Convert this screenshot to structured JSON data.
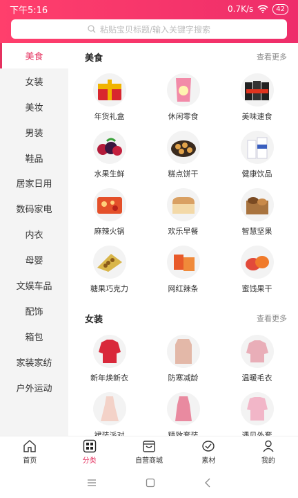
{
  "status": {
    "time": "下午5:16",
    "network": "0.7K/s",
    "battery": "42"
  },
  "search": {
    "placeholder": "粘贴宝贝标题/输入关键字搜索"
  },
  "sidebar": {
    "items": [
      {
        "label": "美食"
      },
      {
        "label": "女装"
      },
      {
        "label": "美妆"
      },
      {
        "label": "男装"
      },
      {
        "label": "鞋品"
      },
      {
        "label": "居家日用"
      },
      {
        "label": "数码家电"
      },
      {
        "label": "内衣"
      },
      {
        "label": "母婴"
      },
      {
        "label": "文娱车品"
      },
      {
        "label": "配饰"
      },
      {
        "label": "箱包"
      },
      {
        "label": "家装家纺"
      },
      {
        "label": "户外运动"
      }
    ]
  },
  "sections": [
    {
      "title": "美食",
      "more": "查看更多",
      "items": [
        {
          "label": "年货礼盒"
        },
        {
          "label": "休闲零食"
        },
        {
          "label": "美味速食"
        },
        {
          "label": "水果生鲜"
        },
        {
          "label": "糕点饼干"
        },
        {
          "label": "健康饮品"
        },
        {
          "label": "麻辣火锅"
        },
        {
          "label": "欢乐早餐"
        },
        {
          "label": "智慧坚果"
        },
        {
          "label": "糖果巧克力"
        },
        {
          "label": "网红辣条"
        },
        {
          "label": "蜜饯果干"
        }
      ]
    },
    {
      "title": "女装",
      "more": "查看更多",
      "items": [
        {
          "label": "新年焕新衣"
        },
        {
          "label": "防寒减龄"
        },
        {
          "label": "温暖毛衣"
        },
        {
          "label": "裙装派对"
        },
        {
          "label": "精致套装"
        },
        {
          "label": "遇见外套"
        }
      ]
    }
  ],
  "tabbar": {
    "items": [
      {
        "label": "首页"
      },
      {
        "label": "分类"
      },
      {
        "label": "自营商城"
      },
      {
        "label": "素材"
      },
      {
        "label": "我的"
      }
    ]
  },
  "colors": {
    "accent": "#e5315f",
    "header": "#ff3f6c"
  }
}
